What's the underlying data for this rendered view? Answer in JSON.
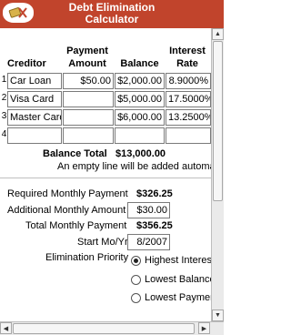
{
  "header": {
    "title_line1": "Debt Elimination",
    "title_line2": "Calculator"
  },
  "table": {
    "headers": {
      "creditor": "Creditor",
      "payment_line1": "Payment",
      "payment_line2": "Amount",
      "balance": "Balance",
      "rate_line1": "Interest",
      "rate_line2": "Rate"
    },
    "rows": [
      {
        "num": "1",
        "creditor": "Car Loan",
        "payment": "$50.00",
        "balance": "$2,000.00",
        "rate": "8.9000%"
      },
      {
        "num": "2",
        "creditor": "Visa Card",
        "payment": "",
        "balance": "$5,000.00",
        "rate": "17.5000%"
      },
      {
        "num": "3",
        "creditor": "Master Card",
        "payment": "",
        "balance": "$6,000.00",
        "rate": "13.2500%"
      },
      {
        "num": "4",
        "creditor": "",
        "payment": "",
        "balance": "",
        "rate": ""
      }
    ],
    "balance_total_label": "Balance Total",
    "balance_total_value": "$13,000.00",
    "note": "An empty line will be added automa"
  },
  "summary": {
    "required_label": "Required Monthly Payment",
    "required_value": "$326.25",
    "additional_label": "Additional Monthly Amount",
    "additional_value": "$30.00",
    "total_label": "Total Monthly Payment",
    "total_value": "$356.25",
    "start_label": "Start Mo/Yr",
    "start_value": "8/2007",
    "priority_label": "Elimination Priority",
    "options": [
      {
        "label": "Highest Interest",
        "selected": true
      },
      {
        "label": "Lowest Balance",
        "selected": false
      },
      {
        "label": "Lowest Payment",
        "selected": false
      }
    ]
  },
  "colors": {
    "header_bg": "#c1442c"
  }
}
